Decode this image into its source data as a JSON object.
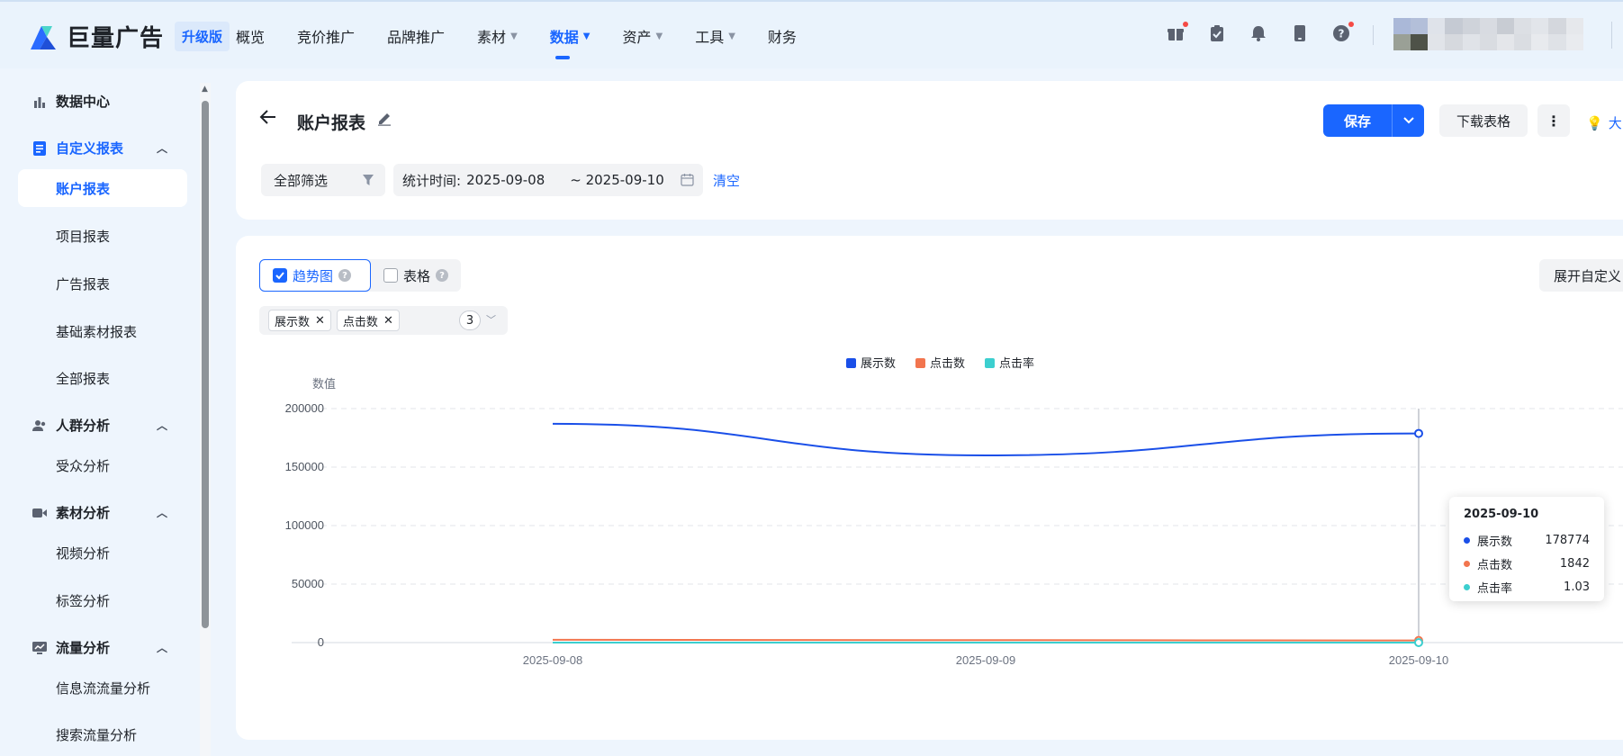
{
  "header": {
    "logo_text": "巨量广告",
    "logo_badge": "升级版",
    "nav": [
      {
        "label": "概览",
        "caret": ""
      },
      {
        "label": "竞价推广",
        "caret": ""
      },
      {
        "label": "品牌推广",
        "caret": ""
      },
      {
        "label": "素材",
        "caret": "▼"
      },
      {
        "label": "数据",
        "caret": "▼"
      },
      {
        "label": "资产",
        "caret": "▼"
      },
      {
        "label": "工具",
        "caret": "▼"
      },
      {
        "label": "财务",
        "caret": ""
      }
    ],
    "active_nav": "数据",
    "icons": [
      "gift-icon",
      "clipboard-icon",
      "bell-icon",
      "tablet-icon",
      "help-icon"
    ]
  },
  "sidebar": {
    "groups": [
      {
        "label": "数据中心",
        "icon": "bar-chart-icon"
      },
      {
        "label": "自定义报表",
        "icon": "report-icon",
        "items": [
          "账户报表",
          "项目报表",
          "广告报表",
          "基础素材报表",
          "全部报表"
        ]
      },
      {
        "label": "人群分析",
        "icon": "people-icon",
        "items": [
          "受众分析"
        ]
      },
      {
        "label": "素材分析",
        "icon": "video-icon",
        "items": [
          "视频分析",
          "标签分析"
        ]
      },
      {
        "label": "流量分析",
        "icon": "monitor-chart-icon",
        "items": [
          "信息流流量分析",
          "搜索流量分析"
        ]
      }
    ],
    "active_item": "账户报表"
  },
  "page": {
    "title": "账户报表",
    "save_label": "保存",
    "download_label": "下载表格",
    "more_label": "⋮",
    "hint_label": "大",
    "filter_label": "全部筛选",
    "date_label": "统计时间:",
    "date_start": "2025-09-08",
    "date_end": "~ 2025-09-10",
    "clear_label": "清空"
  },
  "view": {
    "tab_trend": "趋势图",
    "tab_table": "表格",
    "expand_label": "展开自定义",
    "metric_tags": [
      "展示数",
      "点击数"
    ],
    "metric_count": "3"
  },
  "colors": {
    "primary": "#1a66ff",
    "impressions": "#1a4fe8",
    "clicks": "#f2754e",
    "ctr": "#3ccfcf"
  },
  "chart_data": {
    "type": "line",
    "ylabel": "数值",
    "categories": [
      "2025-09-08",
      "2025-09-09",
      "2025-09-10"
    ],
    "y_ticks": [
      "200000",
      "150000",
      "100000",
      "50000",
      "0"
    ],
    "ylim": [
      0,
      200000
    ],
    "series": [
      {
        "name": "展示数",
        "values": [
          187000,
          160000,
          178774
        ]
      },
      {
        "name": "点击数",
        "values": [
          2400,
          2100,
          1842
        ]
      },
      {
        "name": "点击率",
        "values": [
          1.3,
          1.31,
          1.03
        ]
      }
    ],
    "legend_position": "top-center",
    "grid": true,
    "tooltip": {
      "title": "2025-09-10",
      "rows": [
        {
          "name": "展示数",
          "value": "178774"
        },
        {
          "name": "点击数",
          "value": "1842"
        },
        {
          "name": "点击率",
          "value": "1.03"
        }
      ]
    }
  }
}
